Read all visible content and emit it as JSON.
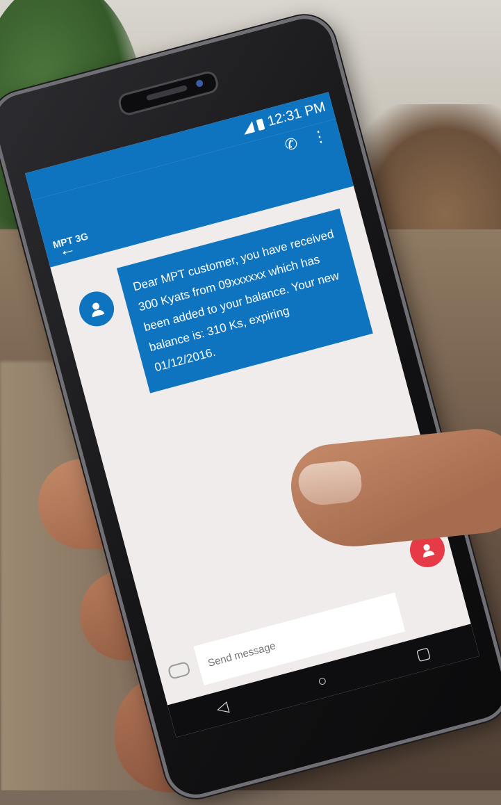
{
  "status_bar": {
    "time": "12:31 PM"
  },
  "toolbar": {
    "carrier": "MPT 3G",
    "back_glyph": "←",
    "call_glyph": "✆",
    "menu_glyph": "⋮"
  },
  "message": {
    "text": "Dear MPT customer, you have received 300 Kyats from 09xxxxxx which has been added to your balance. Your new balance is: 310 Ks, expiring 01/12/2016."
  },
  "compose": {
    "placeholder": "Send message"
  },
  "icons": {
    "avatar": "person-icon",
    "fab": "person-icon",
    "emoji": "emoji-icon"
  },
  "nav": {
    "back": "◁",
    "home": "○",
    "recents": "▢"
  },
  "colors": {
    "accent": "#0f74bf",
    "fab": "#e63a46"
  }
}
